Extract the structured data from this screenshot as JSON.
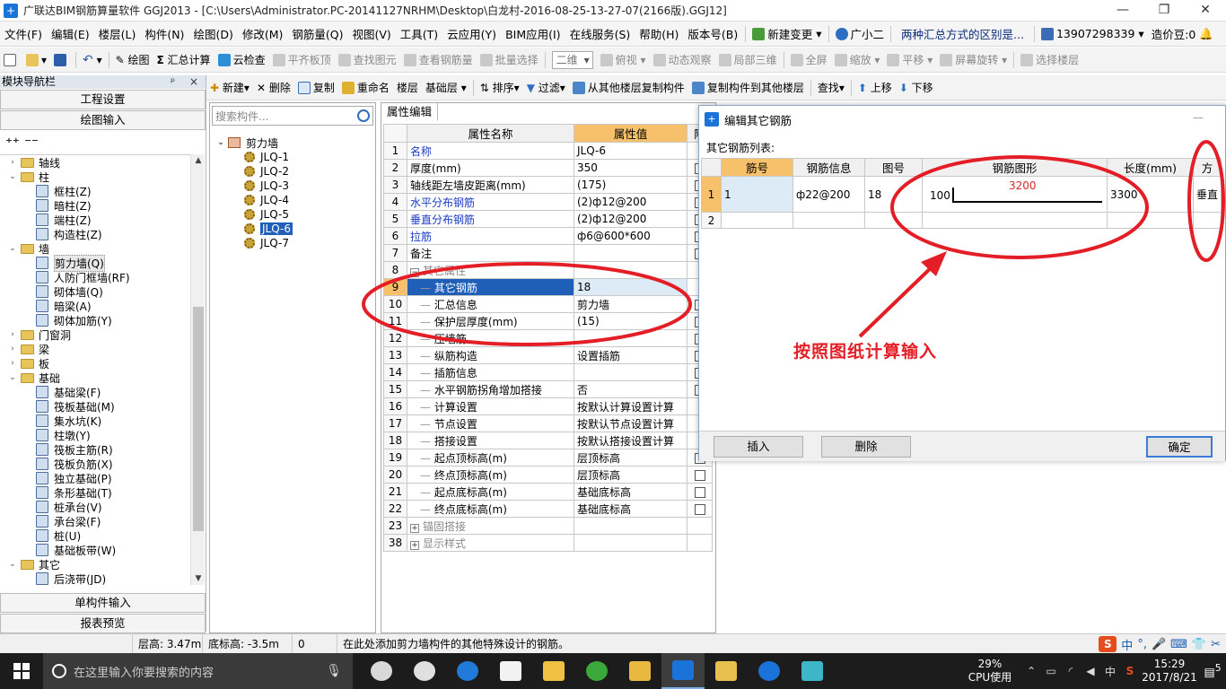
{
  "window": {
    "title": "广联达BIM钢筋算量软件 GGJ2013 - [C:\\Users\\Administrator.PC-20141127NRHM\\Desktop\\白龙村-2016-08-25-13-27-07(2166版).GGJ12]",
    "minimize": "—",
    "restore": "❐",
    "close": "✕"
  },
  "menubar": {
    "items": [
      "文件(F)",
      "编辑(E)",
      "楼层(L)",
      "构件(N)",
      "绘图(D)",
      "修改(M)",
      "钢筋量(Q)",
      "视图(V)",
      "工具(T)",
      "云应用(Y)",
      "BIM应用(I)",
      "在线服务(S)",
      "帮助(H)",
      "版本号(B)"
    ],
    "new_change": "新建变更",
    "assistant": "广小二",
    "link": "两种汇总方式的区别是...",
    "phone": "13907298339",
    "price_coin": "造价豆:0"
  },
  "toolbar1": {
    "draw": "绘图",
    "summary": "汇总计算",
    "cloud_check": "云检查",
    "align_slab": "平齐板顶",
    "find_element": "查找图元",
    "view_rebar": "查看钢筋量",
    "batch_select": "批量选择",
    "view_mode": "二维",
    "top_view": "俯视",
    "dynamic_view": "动态观察",
    "local_3d": "局部三维",
    "full_screen": "全屏",
    "zoom": "缩放",
    "pan": "平移",
    "rotate": "屏幕旋转",
    "select_floor": "选择楼层"
  },
  "toolbar2": {
    "new": "新建",
    "delete": "删除",
    "copy": "复制",
    "rename": "重命名",
    "floor_label": "楼层",
    "floor_value": "基础层",
    "sort": "排序",
    "filter": "过滤",
    "copy_from_floor": "从其他楼层复制构件",
    "copy_to_floor": "复制构件到其他楼层",
    "find": "查找",
    "up": "上移",
    "down": "下移"
  },
  "nav": {
    "header": "模块导航栏",
    "header_icons": "ᵖ ×",
    "project_settings": "工程设置",
    "drawing_input": "绘图输入",
    "single_input": "单构件输入",
    "report_preview": "报表预览",
    "tree": [
      {
        "level": 0,
        "toggle": "›",
        "kind": "folder",
        "label": "轴线"
      },
      {
        "level": 0,
        "toggle": "⌄",
        "kind": "folder",
        "label": "柱"
      },
      {
        "level": 1,
        "kind": "item",
        "label": "框柱(Z)"
      },
      {
        "level": 1,
        "kind": "item",
        "label": "暗柱(Z)"
      },
      {
        "level": 1,
        "kind": "item",
        "label": "端柱(Z)"
      },
      {
        "level": 1,
        "kind": "item",
        "label": "构造柱(Z)"
      },
      {
        "level": 0,
        "toggle": "⌄",
        "kind": "folder",
        "label": "墙"
      },
      {
        "level": 1,
        "kind": "item",
        "label": "剪力墙(Q)",
        "selected": true
      },
      {
        "level": 1,
        "kind": "item",
        "label": "人防门框墙(RF)"
      },
      {
        "level": 1,
        "kind": "item",
        "label": "砌体墙(Q)"
      },
      {
        "level": 1,
        "kind": "item",
        "label": "暗梁(A)"
      },
      {
        "level": 1,
        "kind": "item",
        "label": "砌体加筋(Y)"
      },
      {
        "level": 0,
        "toggle": "›",
        "kind": "folder",
        "label": "门窗洞"
      },
      {
        "level": 0,
        "toggle": "›",
        "kind": "folder",
        "label": "梁"
      },
      {
        "level": 0,
        "toggle": "›",
        "kind": "folder",
        "label": "板"
      },
      {
        "level": 0,
        "toggle": "⌄",
        "kind": "folder",
        "label": "基础"
      },
      {
        "level": 1,
        "kind": "item",
        "label": "基础梁(F)"
      },
      {
        "level": 1,
        "kind": "item",
        "label": "筏板基础(M)"
      },
      {
        "level": 1,
        "kind": "item",
        "label": "集水坑(K)"
      },
      {
        "level": 1,
        "kind": "item",
        "label": "柱墩(Y)"
      },
      {
        "level": 1,
        "kind": "item",
        "label": "筏板主筋(R)"
      },
      {
        "level": 1,
        "kind": "item",
        "label": "筏板负筋(X)"
      },
      {
        "level": 1,
        "kind": "item",
        "label": "独立基础(P)"
      },
      {
        "level": 1,
        "kind": "item",
        "label": "条形基础(T)"
      },
      {
        "level": 1,
        "kind": "item",
        "label": "桩承台(V)"
      },
      {
        "level": 1,
        "kind": "item",
        "label": "承台梁(F)"
      },
      {
        "level": 1,
        "kind": "item",
        "label": "桩(U)"
      },
      {
        "level": 1,
        "kind": "item",
        "label": "基础板带(W)"
      },
      {
        "level": 0,
        "toggle": "⌄",
        "kind": "folder",
        "label": "其它"
      },
      {
        "level": 1,
        "kind": "item",
        "label": "后浇带(JD)"
      }
    ]
  },
  "components": {
    "search_placeholder": "搜索构件...",
    "root": "剪力墙",
    "items": [
      "JLQ-1",
      "JLQ-2",
      "JLQ-3",
      "JLQ-4",
      "JLQ-5",
      "JLQ-6",
      "JLQ-7"
    ],
    "selected_index": 5
  },
  "properties": {
    "tab": "属性编辑",
    "col_name": "属性名称",
    "col_value": "属性值",
    "col_extra": "附",
    "rows": [
      {
        "no": "1",
        "name": "名称",
        "value": "JLQ-6",
        "blue": true,
        "check": false
      },
      {
        "no": "2",
        "name": "厚度(mm)",
        "value": "350",
        "check": true
      },
      {
        "no": "3",
        "name": "轴线距左墙皮距离(mm)",
        "value": "(175)",
        "check": true
      },
      {
        "no": "4",
        "name": "水平分布钢筋",
        "value": "(2)ф12@200",
        "blue": true,
        "check": true
      },
      {
        "no": "5",
        "name": "垂直分布钢筋",
        "value": "(2)ф12@200",
        "blue": true,
        "check": true
      },
      {
        "no": "6",
        "name": "拉筋",
        "value": "ф6@600*600",
        "blue": true,
        "check": true
      },
      {
        "no": "7",
        "name": "备注",
        "value": "",
        "check": true
      },
      {
        "no": "8",
        "name": "其它属性",
        "value": "",
        "group": true
      },
      {
        "no": "9",
        "name": "其它钢筋",
        "value": "18",
        "indent": true,
        "hilite": true
      },
      {
        "no": "10",
        "name": "汇总信息",
        "value": "剪力墙",
        "indent": true,
        "check": true
      },
      {
        "no": "11",
        "name": "保护层厚度(mm)",
        "value": "(15)",
        "indent": true,
        "check": true
      },
      {
        "no": "12",
        "name": "压墙筋",
        "value": "",
        "indent": true,
        "check": true
      },
      {
        "no": "13",
        "name": "纵筋构造",
        "value": "设置插筋",
        "indent": true,
        "check": true
      },
      {
        "no": "14",
        "name": "插筋信息",
        "value": "",
        "indent": true,
        "check": true
      },
      {
        "no": "15",
        "name": "水平钢筋拐角增加搭接",
        "value": "否",
        "indent": true,
        "check": true
      },
      {
        "no": "16",
        "name": "计算设置",
        "value": "按默认计算设置计算",
        "indent": true,
        "check": false
      },
      {
        "no": "17",
        "name": "节点设置",
        "value": "按默认节点设置计算",
        "indent": true,
        "check": false
      },
      {
        "no": "18",
        "name": "搭接设置",
        "value": "按默认搭接设置计算",
        "indent": true,
        "check": false
      },
      {
        "no": "19",
        "name": "起点顶标高(m)",
        "value": "层顶标高",
        "indent": true,
        "check": true
      },
      {
        "no": "20",
        "name": "终点顶标高(m)",
        "value": "层顶标高",
        "indent": true,
        "check": true
      },
      {
        "no": "21",
        "name": "起点底标高(m)",
        "value": "基础底标高",
        "indent": true,
        "check": true
      },
      {
        "no": "22",
        "name": "终点底标高(m)",
        "value": "基础底标高",
        "indent": true,
        "check": true
      },
      {
        "no": "23",
        "name": "锚固搭接",
        "value": "",
        "collapsed": true
      },
      {
        "no": "38",
        "name": "显示样式",
        "value": "",
        "collapsed": true
      }
    ]
  },
  "dialog": {
    "title": "编辑其它钢筋",
    "list_label": "其它钢筋列表:",
    "cols": [
      "筋号",
      "钢筋信息",
      "图号",
      "钢筋图形",
      "长度(mm)",
      "方"
    ],
    "rows": [
      {
        "idx": "1",
        "bar_no": "1",
        "info": "ф22@200",
        "shape_no": "18",
        "hook": "100",
        "main_len": "3200",
        "length": "3300",
        "dir": "垂直"
      },
      {
        "idx": "2",
        "bar_no": "",
        "info": "",
        "shape_no": "",
        "hook": "",
        "main_len": "",
        "length": "",
        "dir": ""
      }
    ],
    "insert": "插入",
    "delete": "删除",
    "ok": "确定"
  },
  "annotation": {
    "text": "按照图纸计算输入",
    "color": "#e41e26"
  },
  "statusbar": {
    "floor_height": "层高: 3.47m",
    "base_elev": "底标高: -3.5m",
    "zero": "0",
    "hint": "在此处添加剪力墙构件的其他特殊设计的钢筋。",
    "ime_logo": "S",
    "ime_lang": "中",
    "ime_punct": "°,"
  },
  "taskbar": {
    "search_placeholder": "在这里输入你要搜索的内容",
    "cpu_pct": "29%",
    "cpu_label": "CPU使用",
    "ime": "中",
    "time": "15:29",
    "date": "2017/8/21",
    "notif_count": "5"
  },
  "colors": {
    "accent": "#1f5fb8",
    "anno_red": "#e41e26"
  }
}
